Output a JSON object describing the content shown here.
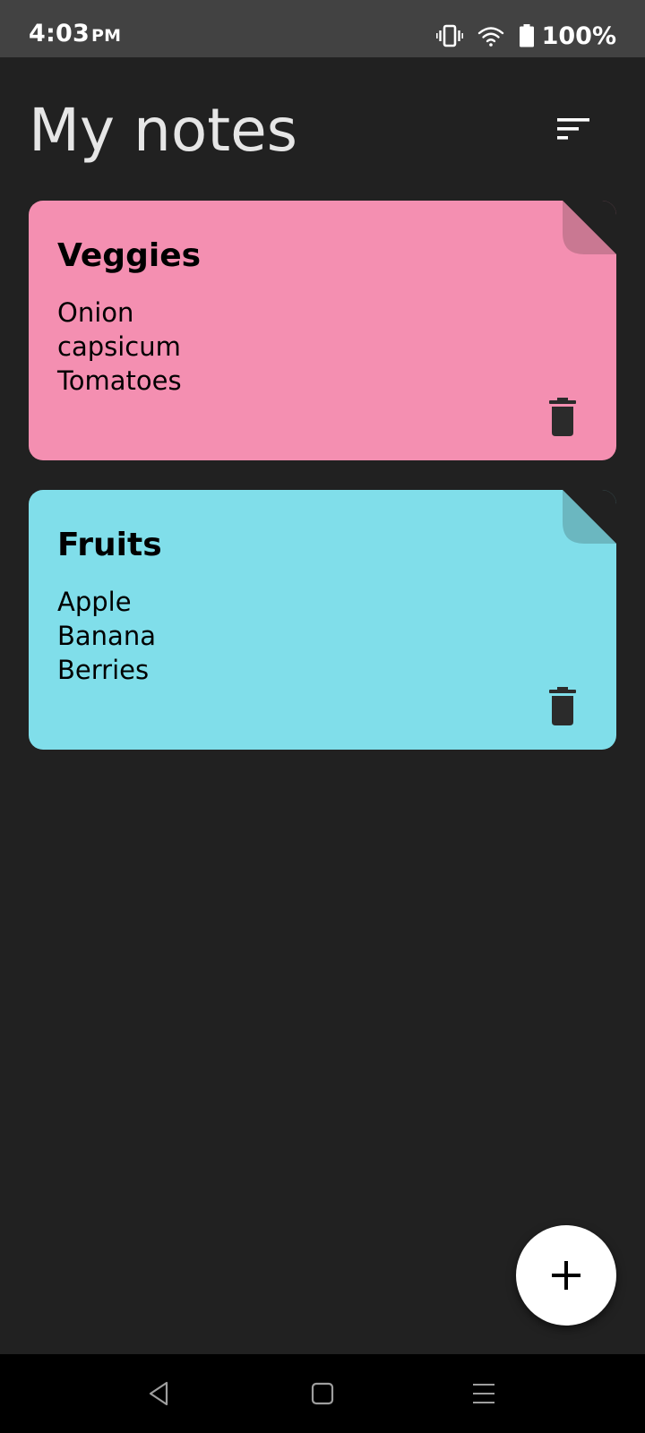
{
  "status_bar": {
    "time": "4:03",
    "ampm": "PM",
    "battery_percent": "100%",
    "icons": [
      "vibrate-icon",
      "wifi-icon",
      "battery-icon"
    ]
  },
  "header": {
    "title": "My notes",
    "sort_icon": "sort-icon"
  },
  "notes": [
    {
      "title": "Veggies",
      "lines": [
        "Onion",
        "capsicum",
        "Tomatoes"
      ],
      "color": "#f48fb1",
      "delete_icon": "trash-icon"
    },
    {
      "title": "Fruits",
      "lines": [
        "Apple",
        "Banana",
        "Berries"
      ],
      "color": "#80deea",
      "delete_icon": "trash-icon"
    }
  ],
  "fab": {
    "icon": "plus-icon"
  },
  "nav_bar": {
    "icons": [
      "back-icon",
      "home-icon",
      "recents-icon"
    ]
  },
  "colors": {
    "background": "#212121",
    "status_bar": "#424242",
    "nav_bar": "#000000",
    "title_text": "#e6e6e6",
    "fab": "#ffffff"
  }
}
